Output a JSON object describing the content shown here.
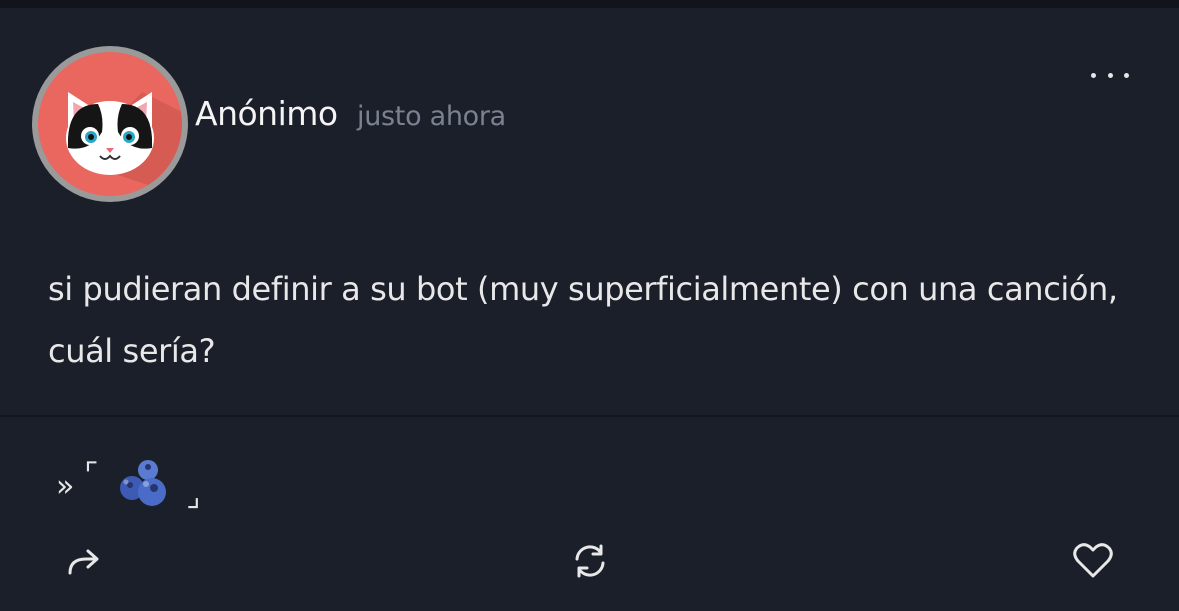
{
  "post": {
    "author": "Anónimo",
    "time": "justo ahora",
    "text": "si pudieran definir a su bot (muy superficialmente) con una canción, cuál sería?"
  },
  "reply": {
    "prefix": "»",
    "bracket_open": "⌜",
    "emoji": "🫐",
    "bracket_close": "⌟"
  },
  "icons": {
    "more": "more-dots-icon",
    "share": "share-arrow-icon",
    "repost": "repost-icon",
    "like": "heart-icon"
  },
  "colors": {
    "background": "#1b1f2a",
    "avatar_bg": "#e9675e",
    "text": "#e8e8e8",
    "muted": "#7b8190"
  }
}
